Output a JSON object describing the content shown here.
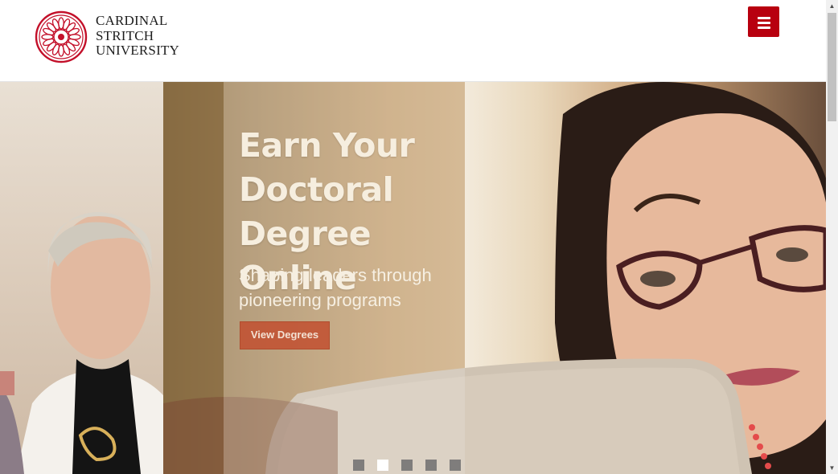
{
  "header": {
    "logo_lines": [
      "CARDINAL",
      "STRITCH",
      "UNIVERSITY"
    ],
    "brand_color": "#b8000f",
    "menu_icon": "hamburger-icon"
  },
  "hero": {
    "title": "Earn Your Doctoral Degree Online",
    "subtitle": "Shaping leaders through pioneering programs",
    "cta_label": "View Degrees",
    "cta_color": "#c14f30",
    "carousel": {
      "slide_count": 5,
      "active_index": 1
    }
  },
  "scrollbar": {
    "up_icon": "scroll-up-arrow-icon",
    "down_icon": "scroll-down-arrow-icon"
  }
}
